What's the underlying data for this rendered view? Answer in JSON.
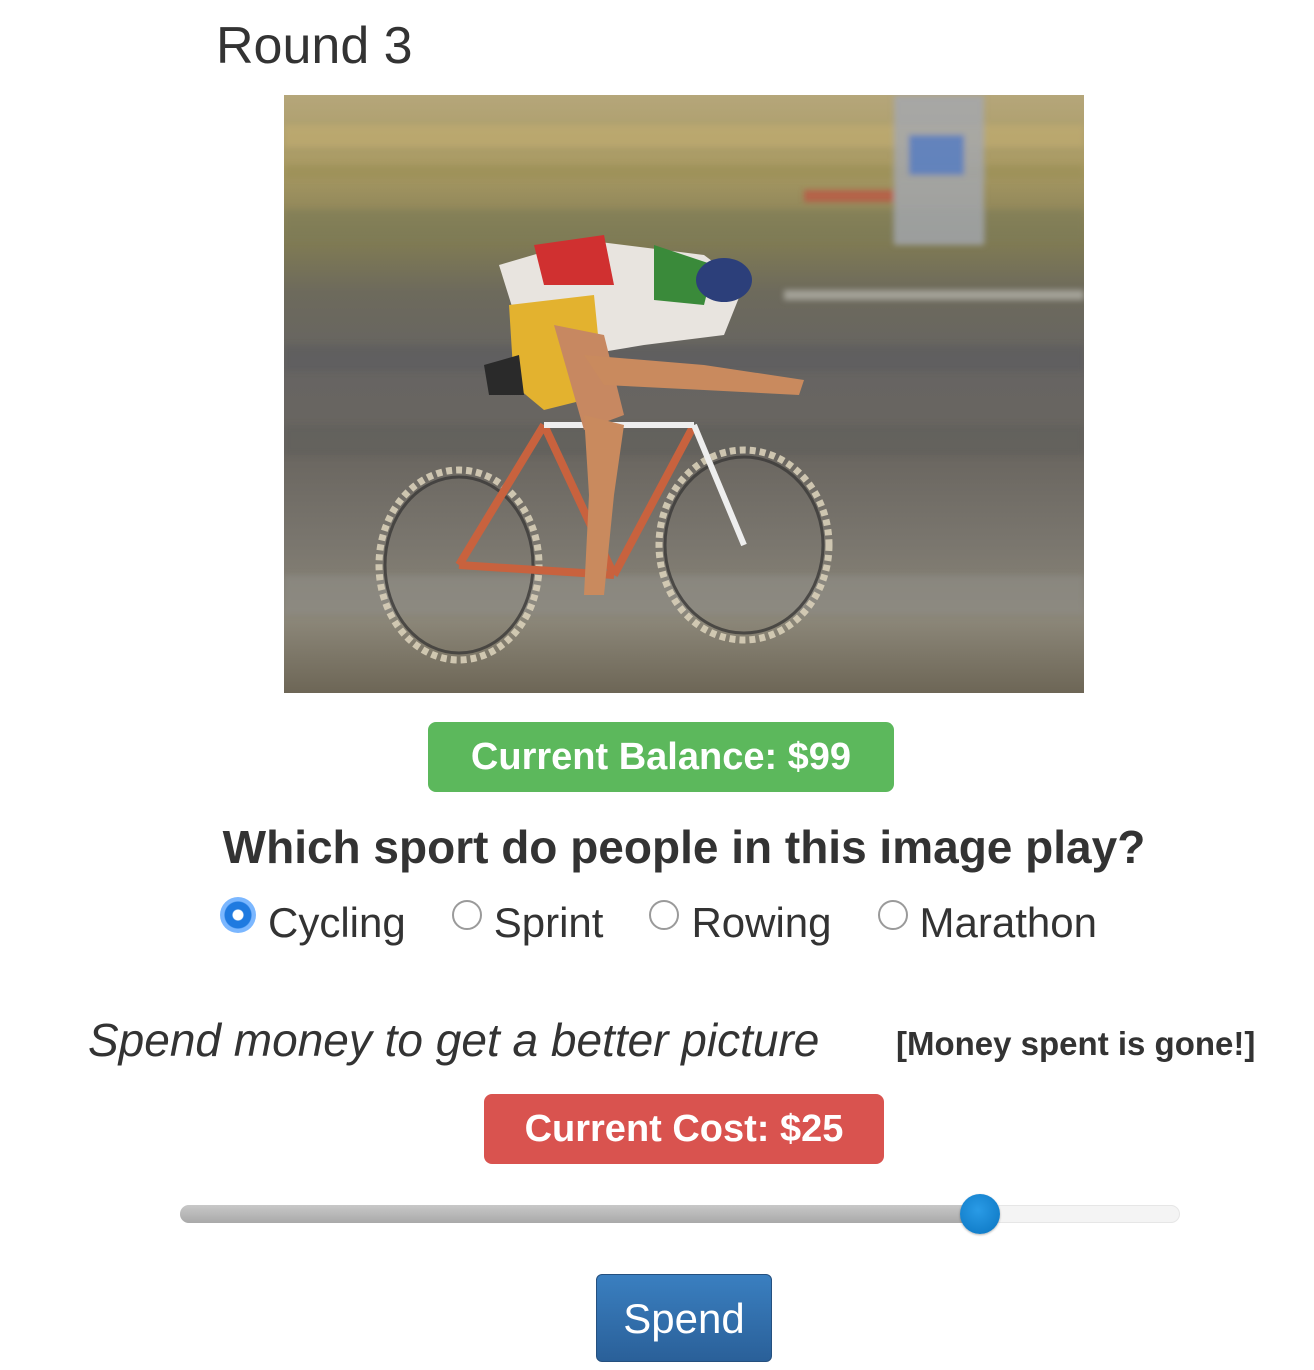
{
  "round": {
    "title": "Round 3"
  },
  "balance": {
    "label": "Current Balance: $99"
  },
  "question": {
    "text": "Which sport do people in this image play?",
    "options": [
      {
        "label": "Cycling",
        "selected": true
      },
      {
        "label": "Sprint",
        "selected": false
      },
      {
        "label": "Rowing",
        "selected": false
      },
      {
        "label": "Marathon",
        "selected": false
      }
    ]
  },
  "spend": {
    "prompt": "Spend money to get a better picture",
    "note": "[Money spent is gone!]",
    "cost_label": "Current Cost: $25",
    "slider_fraction": 0.8,
    "button_label": "Spend"
  },
  "colors": {
    "balance_badge": "#5cb85c",
    "cost_badge": "#d9534f",
    "spend_button": "#2a6099",
    "slider_thumb": "#0a74c0",
    "radio_selected": "#1f7ae0"
  }
}
